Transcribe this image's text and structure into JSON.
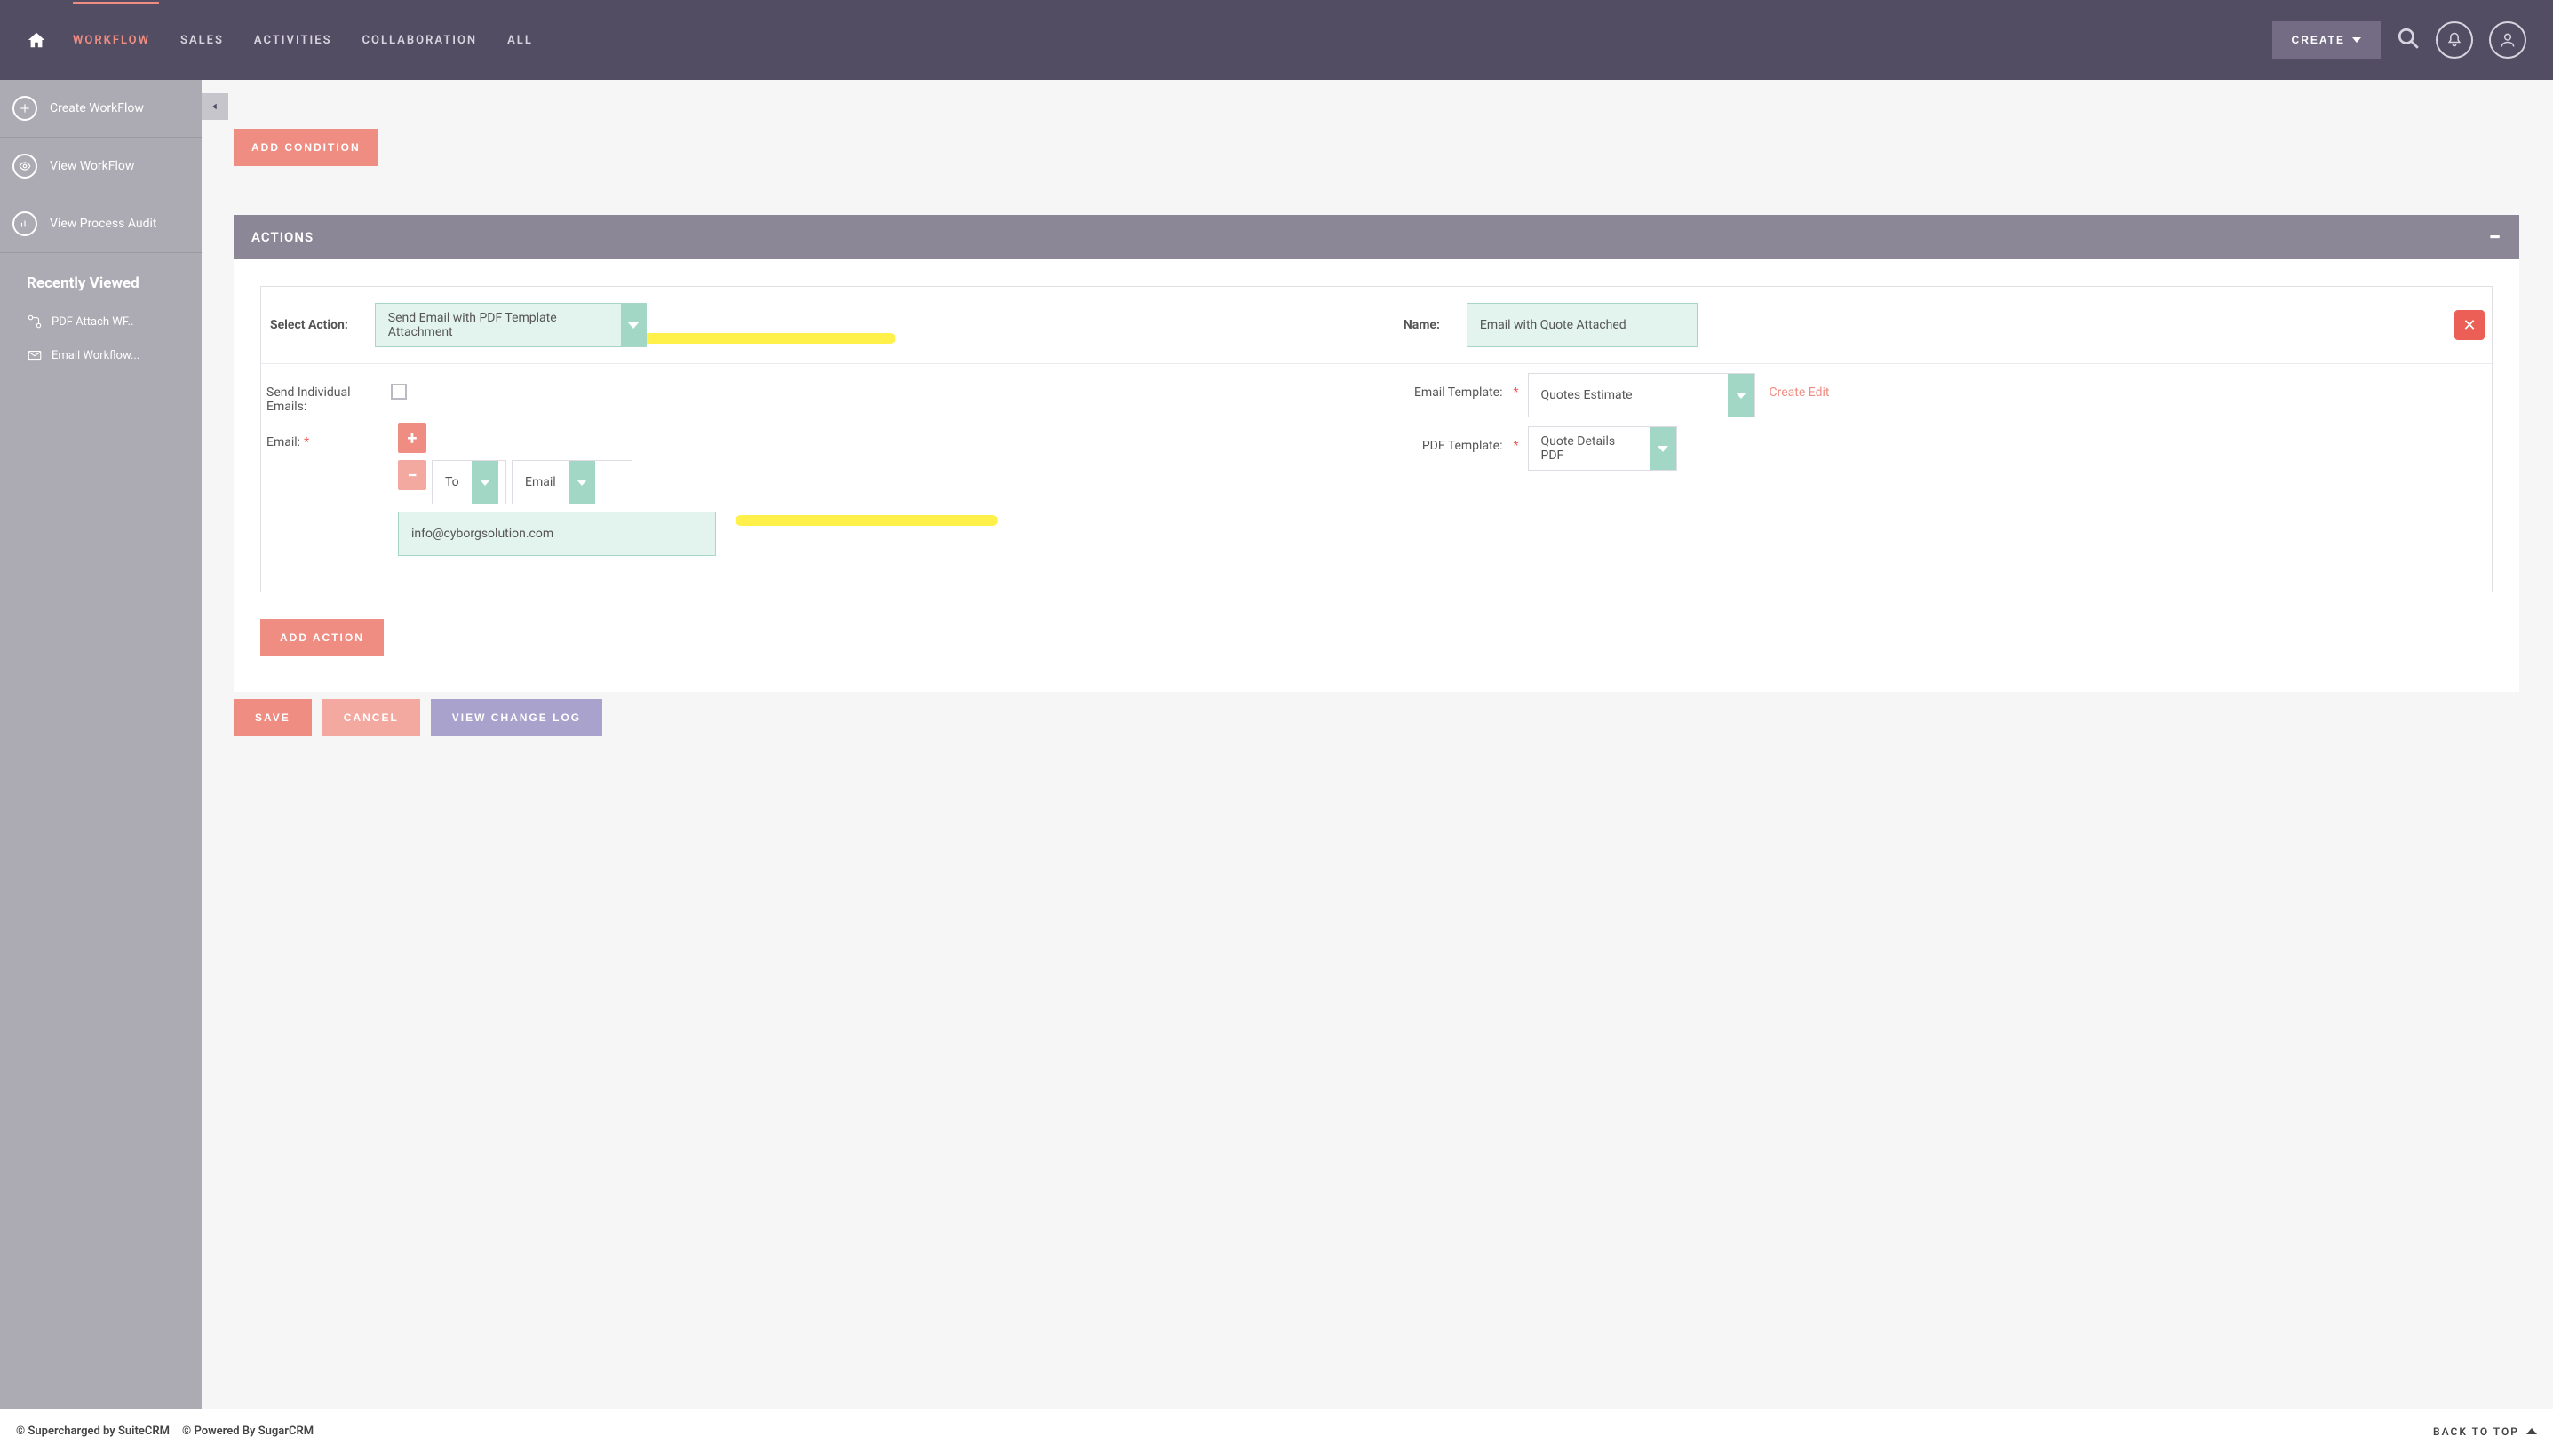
{
  "nav": {
    "items": [
      "WORKFLOW",
      "SALES",
      "ACTIVITIES",
      "COLLABORATION",
      "ALL"
    ],
    "active_index": 0,
    "create_label": "CREATE"
  },
  "sidebar": {
    "items": [
      {
        "label": "Create WorkFlow"
      },
      {
        "label": "View WorkFlow"
      },
      {
        "label": "View Process Audit"
      }
    ],
    "recent_title": "Recently Viewed",
    "recent": [
      {
        "label": "PDF Attach WF.."
      },
      {
        "label": "Email Workflow..."
      }
    ]
  },
  "conditions": {
    "add_button": "ADD CONDITION"
  },
  "actions_panel": {
    "title": "ACTIONS",
    "select_action_label": "Select Action:",
    "select_action_value": "Send Email with PDF Template Attachment",
    "name_label": "Name:",
    "name_value": "Email with Quote Attached",
    "send_individual_label": "Send Individual Emails:",
    "email_label": "Email:",
    "email_to": "To",
    "email_type": "Email",
    "email_value": "info@cyborgsolution.com",
    "email_template_label": "Email Template:",
    "email_template_value": "Quotes Estimate",
    "email_template_links": "Create Edit",
    "pdf_template_label": "PDF Template:",
    "pdf_template_value": "Quote Details PDF",
    "add_action_button": "ADD ACTION"
  },
  "bottom": {
    "save": "SAVE",
    "cancel": "CANCEL",
    "view_log": "VIEW CHANGE LOG"
  },
  "footer": {
    "copy1": "© Supercharged by SuiteCRM",
    "copy2": "© Powered By SugarCRM",
    "back_top": "BACK TO TOP"
  }
}
